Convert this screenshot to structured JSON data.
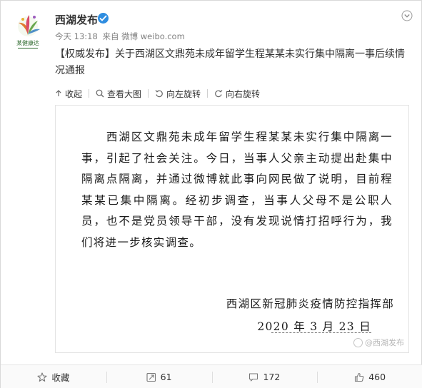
{
  "account": {
    "name": "西湖发布",
    "time": "今天 13:18",
    "source": "来自 微博 weibo.com",
    "avatar_text": "某健康达"
  },
  "post": {
    "tag": "【权威发布】",
    "text": "关于西湖区文鼎苑未成年留学生程某某未实行集中隔离一事后续情况通报"
  },
  "image_toolbar": {
    "collapse": "收起",
    "view_large": "查看大图",
    "rotate_left": "向左旋转",
    "rotate_right": "向右旋转"
  },
  "image": {
    "statement": "　　西湖区文鼎苑未成年留学生程某某未实行集中隔离一事，引起了社会关注。今日，当事人父亲主动提出赴集中隔离点隔离，并通过微博就此事向网民做了说明，目前程某某已集中隔离。经初步调查，当事人父母不是公职人员，也不是党员领导干部，没有发现说情打招呼行为，我们将进一步核实调查。",
    "signer": "西湖区新冠肺炎疫情防控指挥部",
    "date": "2020 年 3 月 23 日",
    "watermark": "@西湖发布"
  },
  "actions": {
    "favorite": "收藏",
    "repost": "61",
    "comment": "172",
    "like": "460"
  },
  "colors": {
    "verified": "#2e8de0",
    "meta_text": "#808080"
  }
}
